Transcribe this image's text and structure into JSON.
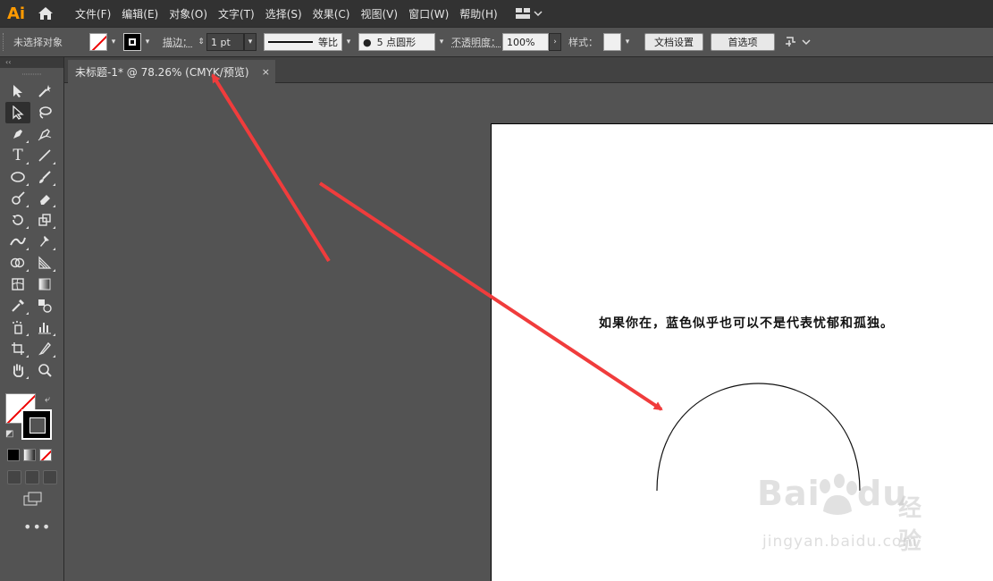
{
  "app": {
    "logo": "Ai",
    "accent": "#ff9a00"
  },
  "menu": {
    "items": [
      "文件(F)",
      "编辑(E)",
      "对象(O)",
      "文字(T)",
      "选择(S)",
      "效果(C)",
      "视图(V)",
      "窗口(W)",
      "帮助(H)"
    ]
  },
  "control": {
    "selection_status": "未选择对象",
    "stroke_label": "描边：",
    "stroke_weight": "1 pt",
    "stroke_profile": "等比",
    "brush_label": "5 点圆形",
    "opacity_label": "不透明度：",
    "opacity_value": "100%",
    "style_label": "样式：",
    "doc_setup_button": "文档设置",
    "preferences_button": "首选项"
  },
  "tab": {
    "title": "未标题-1* @ 78.26% (CMYK/预览)",
    "close": "×"
  },
  "toolbar": {
    "collapse": "‹‹",
    "more": "•••"
  },
  "artboard": {
    "text": "如果你在，蓝色似乎也可以不是代表忧郁和孤独。"
  },
  "watermark": {
    "brand": "Bai",
    "brand2": "du",
    "cn": "经验",
    "url": "jingyan.baidu.com"
  },
  "annotation": {
    "arrow_color": "#f03c3c"
  }
}
